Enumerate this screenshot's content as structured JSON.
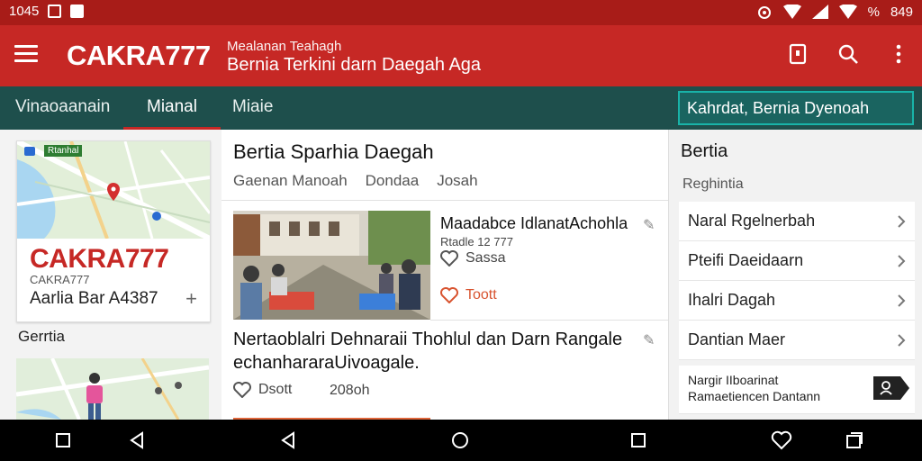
{
  "status": {
    "time_left": "1045",
    "time_right": "849",
    "battery": "%"
  },
  "app": {
    "brand": "CAKRA777",
    "subtitle": "Mealanan Teahagh",
    "title": "Bernia Terkini darn Daegah Aga"
  },
  "tabs": [
    {
      "label": "Vinaoaanain"
    },
    {
      "label": "Mianal"
    },
    {
      "label": "Miaie"
    }
  ],
  "right_panel": {
    "search_value": "Kahrdat, Bernia Dyenoah",
    "title": "Bertia",
    "subtitle": "Reghintia",
    "items": [
      {
        "label": "Naral Rgelnerbah"
      },
      {
        "label": "Pteifi Daeidaarn"
      },
      {
        "label": "Ihalri Dagah"
      },
      {
        "label": "Dantian Maer"
      }
    ],
    "last_item": {
      "line1": "Nargir IIboarinat",
      "line2": "Ramaetiencen Dantann"
    }
  },
  "left_panel": {
    "card_brand": "CAKRA777",
    "card_brand_sub": "CAKRA777",
    "card_text": "Aarlia Bar A4387",
    "section_label": "Gerrtia",
    "map_chip": "Rtanhal",
    "plus": "+"
  },
  "middle": {
    "section_title": "Bertia  Sparhia Daegah",
    "filters": [
      "Gaenan Manoah",
      "Dondaa",
      "Josah"
    ],
    "article1": {
      "title": "Maadabce IdlanatAchohla",
      "date": "Rtadle 12 777",
      "likes": "Sassa",
      "likes_label_2": "Toott"
    },
    "article2": {
      "title": "Nertaoblalri Dehnaraii Thohlul dan Darn Rangale echanhararaUivoagale.",
      "likes": "Dsott",
      "time": "208oh"
    }
  },
  "colors": {
    "appbar": "#c62825",
    "statusbar": "#a81c18",
    "tabbar": "#1e4f4c",
    "accent_teal": "#19b3a8"
  }
}
